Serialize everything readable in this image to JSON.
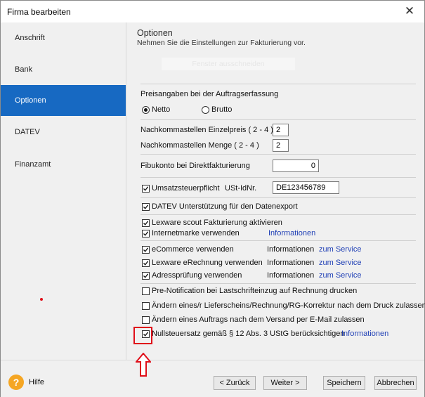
{
  "window": {
    "title": "Firma bearbeiten",
    "close_symbol": "✕"
  },
  "sidebar": {
    "items": [
      {
        "label": "Anschrift",
        "active": false
      },
      {
        "label": "Bank",
        "active": false
      },
      {
        "label": "Optionen",
        "active": true
      },
      {
        "label": "DATEV",
        "active": false
      },
      {
        "label": "Finanzamt",
        "active": false
      }
    ]
  },
  "main": {
    "heading": "Optionen",
    "subheading": "Nehmen Sie die Einstellungen zur Fakturierung vor.",
    "ghost_button": "Fenster ausschneiden",
    "preisangaben": {
      "label": "Preisangaben bei der Auftragserfassung",
      "netto": "Netto",
      "brutto": "Brutto",
      "selected": "Netto"
    },
    "nachkomma_einzelpreis": {
      "label": "Nachkommastellen Einzelpreis ( 2 - 4 )",
      "value": "2"
    },
    "nachkomma_menge": {
      "label": "Nachkommastellen Menge ( 2 - 4 )",
      "value": "2"
    },
    "fibukonto": {
      "label": "Fibukonto bei Direktfakturierung",
      "value": "0"
    },
    "umsatzsteuer": {
      "label": "Umsatzsteuerpflicht",
      "checked": true,
      "ustid_label": "USt-IdNr.",
      "ustid_value": "DE123456789"
    },
    "datev": {
      "label": "DATEV Unterstützung für den Datenexport",
      "checked": true
    },
    "scout": {
      "label": "Lexware scout Fakturierung aktivieren",
      "checked": true
    },
    "internetmarke": {
      "label": "Internetmarke verwenden",
      "checked": true,
      "info_link": "Informationen"
    },
    "ecommerce": {
      "label": "eCommerce verwenden",
      "checked": true,
      "info": "Informationen",
      "service_link": "zum Service"
    },
    "erechnung": {
      "label": "Lexware eRechnung verwenden",
      "checked": true,
      "info": "Informationen",
      "service_link": "zum Service"
    },
    "adresspruefung": {
      "label": "Adressprüfung verwenden",
      "checked": true,
      "info": "Informationen",
      "service_link": "zum Service"
    },
    "prenotification": {
      "label": "Pre-Notification bei Lastschrifteinzug auf Rechnung drucken",
      "checked": false
    },
    "aendern_lieferschein": {
      "label": "Ändern eines/r Lieferscheins/Rechnung/RG-Korrektur nach dem Druck zulassen",
      "checked": false
    },
    "aendern_auftrag": {
      "label": "Ändern eines Auftrags nach dem Versand per E-Mail zulassen",
      "checked": false
    },
    "nullsteuersatz": {
      "label": "Nullsteuersatz gemäß § 12 Abs. 3 UStG berücksichtigen",
      "checked": true,
      "info_link": "Informationen"
    }
  },
  "footer": {
    "help_symbol": "?",
    "help": "Hilfe",
    "back": "< Zurück",
    "next": "Weiter >",
    "save": "Speichern",
    "cancel": "Abbrechen"
  },
  "colors": {
    "accent": "#1769c2",
    "link": "#1f3fb5",
    "annotation": "#e0101a",
    "help": "#f5a623"
  }
}
